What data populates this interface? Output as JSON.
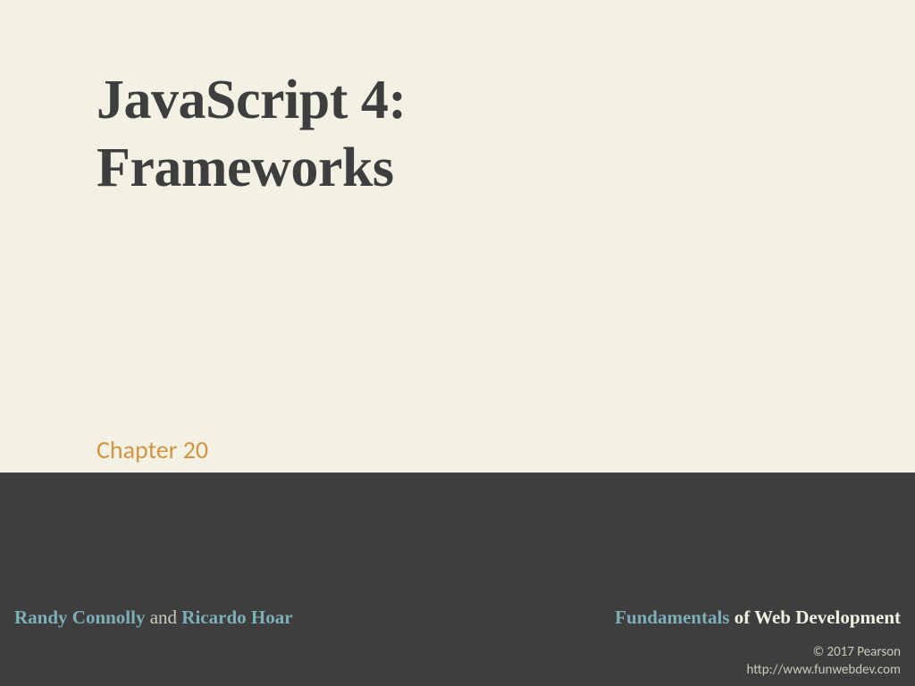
{
  "title_line1": "JavaScript 4:",
  "title_line2": "Frameworks",
  "chapter": "Chapter 20",
  "authors": {
    "first": "Randy Connolly",
    "connector": " and ",
    "second": "Ricardo Hoar"
  },
  "book": {
    "first_word": "Fundamentals",
    "rest": " of Web Development"
  },
  "copyright_line1": "© 2017 Pearson",
  "copyright_line2": "http://www.funwebdev.com"
}
